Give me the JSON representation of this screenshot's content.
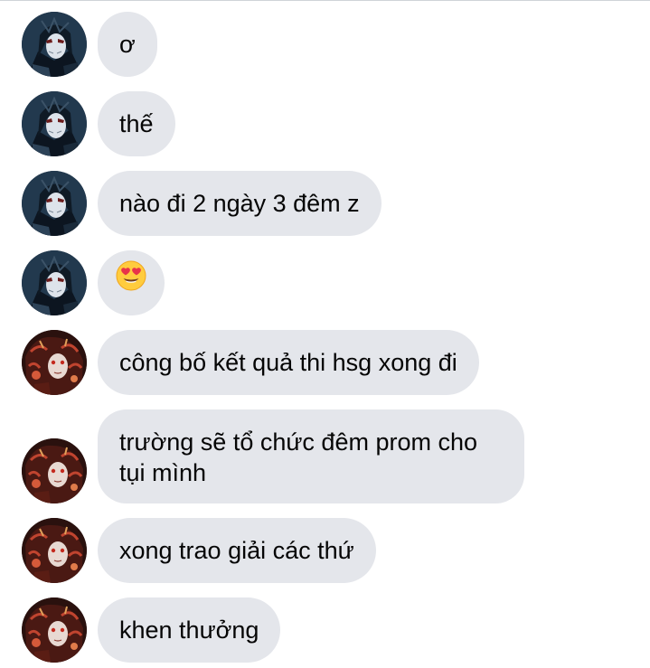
{
  "messages": [
    {
      "text": "ơ",
      "sender": "black-hair-avatar"
    },
    {
      "text": "thế",
      "sender": "black-hair-avatar"
    },
    {
      "text": "nào đi 2 ngày 3 đêm z",
      "sender": "black-hair-avatar"
    },
    {
      "text": "",
      "emoji": "heart-eyes-emoji-icon",
      "sender": "black-hair-avatar"
    },
    {
      "text": "công bố kết quả thi hsg xong đi",
      "sender": "red-hair-avatar"
    },
    {
      "text": "trường sẽ tổ chức đêm prom cho tụi mình",
      "sender": "red-hair-avatar"
    },
    {
      "text": "xong trao giải các thứ",
      "sender": "red-hair-avatar"
    },
    {
      "text": "khen thưởng",
      "sender": "red-hair-avatar"
    }
  ],
  "colors": {
    "bubble": "#e4e6eb",
    "text": "#050505",
    "background": "#ffffff"
  }
}
